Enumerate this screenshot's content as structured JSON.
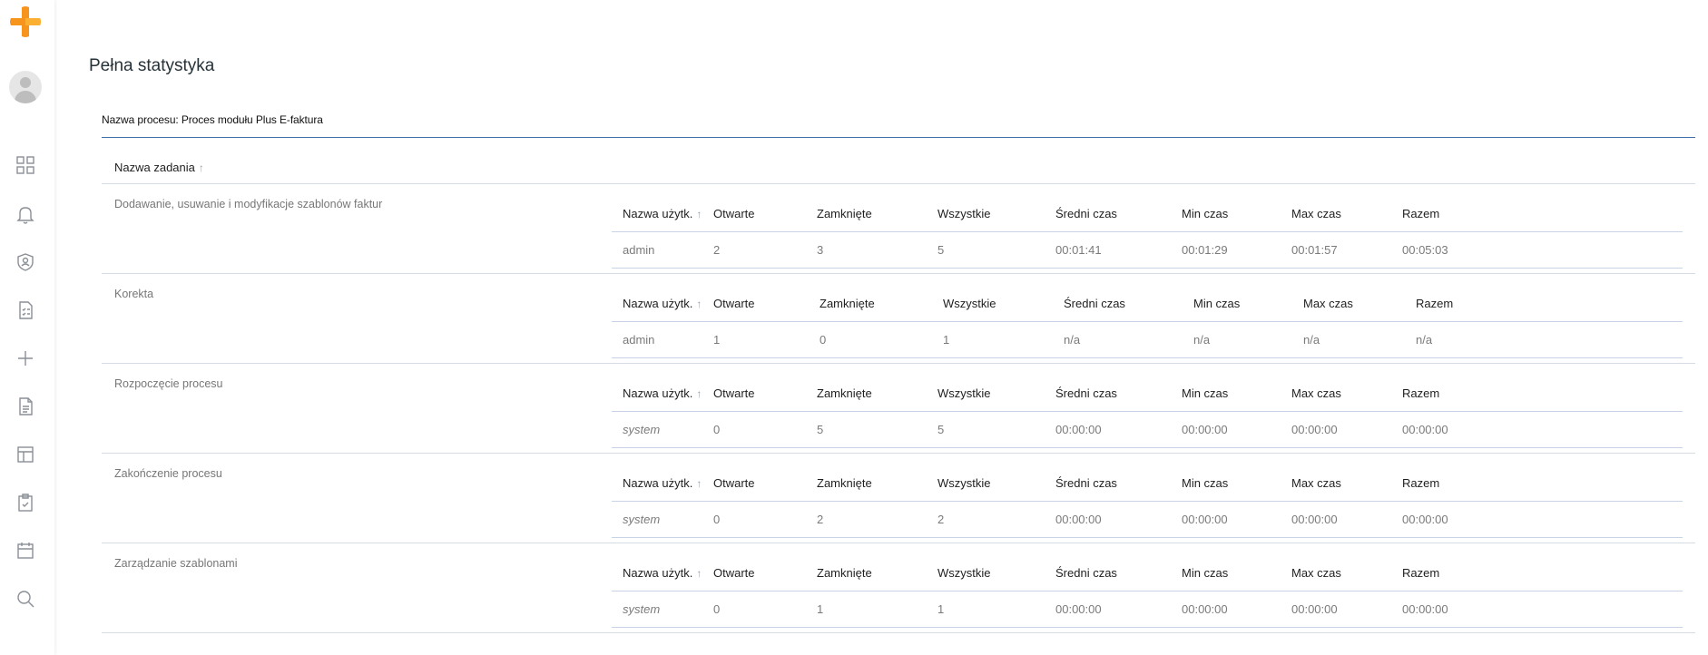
{
  "sidebar": {
    "logo": "plus-logo",
    "avatar": "user-avatar",
    "icons": [
      "dashboard-icon",
      "bell-icon",
      "shield-user-icon",
      "task-list-icon",
      "plus-icon",
      "document-icon",
      "layout-icon",
      "clipboard-check-icon",
      "calendar-icon",
      "search-icon"
    ]
  },
  "page": {
    "title": "Pełna statystyka",
    "process_line": "Nazwa procesu: Proces modułu Plus E-faktura",
    "task_column_header": "Nazwa zadania",
    "sort_arrow": "↑"
  },
  "subtable_headers": [
    "Nazwa użytk.",
    "Otwarte",
    "Zamknięte",
    "Wszystkie",
    "Średni czas",
    "Min czas",
    "Max czas",
    "Razem"
  ],
  "tasks": [
    {
      "name": "Dodawanie, usuwanie i modyfikacje szablonów faktur",
      "row": {
        "user": "admin",
        "opened": "2",
        "closed": "3",
        "all": "5",
        "avg": "00:01:41",
        "min": "00:01:29",
        "max": "00:01:57",
        "total": "00:05:03"
      }
    },
    {
      "name": "Korekta",
      "row": {
        "user": "admin",
        "opened": "1",
        "closed": "0",
        "all": "1",
        "avg": "n/a",
        "min": "n/a",
        "max": "n/a",
        "total": "n/a"
      }
    },
    {
      "name": "Rozpoczęcie procesu",
      "row": {
        "user": "system",
        "opened": "0",
        "closed": "5",
        "all": "5",
        "avg": "00:00:00",
        "min": "00:00:00",
        "max": "00:00:00",
        "total": "00:00:00"
      }
    },
    {
      "name": "Zakończenie procesu",
      "row": {
        "user": "system",
        "opened": "0",
        "closed": "2",
        "all": "2",
        "avg": "00:00:00",
        "min": "00:00:00",
        "max": "00:00:00",
        "total": "00:00:00"
      }
    },
    {
      "name": "Zarządzanie szablonami",
      "row": {
        "user": "system",
        "opened": "0",
        "closed": "1",
        "all": "1",
        "avg": "00:00:00",
        "min": "00:00:00",
        "max": "00:00:00",
        "total": "00:00:00"
      }
    }
  ],
  "colors": {
    "accent": "#3f71a9",
    "logo_orange": "#f7941d",
    "logo_yellow": "#fbb034"
  }
}
